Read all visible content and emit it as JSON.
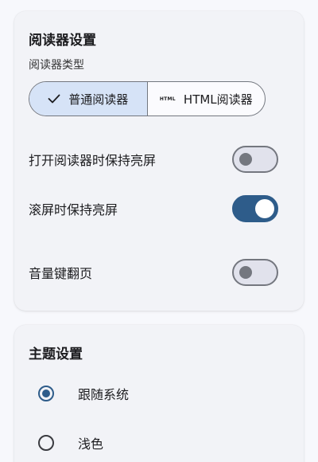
{
  "colors": {
    "accent": "#2e5c8a",
    "selected_segment": "#d6e3f7",
    "card_bg": "#f2f3f7",
    "page_bg": "#f7f8fc"
  },
  "reader_settings": {
    "title": "阅读器设置",
    "type_label": "阅读器类型",
    "type_options": [
      {
        "label": "普通阅读器",
        "icon": "check-icon",
        "selected": true
      },
      {
        "label": "HTML阅读器",
        "icon_text": "HTML",
        "selected": false
      }
    ],
    "toggles": [
      {
        "label": "打开阅读器时保持亮屏",
        "on": false
      },
      {
        "label": "滚屏时保持亮屏",
        "on": true
      },
      {
        "label": "音量键翻页",
        "on": false
      }
    ]
  },
  "theme_settings": {
    "title": "主题设置",
    "options": [
      {
        "label": "跟随系统",
        "selected": true
      },
      {
        "label": "浅色",
        "selected": false
      }
    ]
  }
}
